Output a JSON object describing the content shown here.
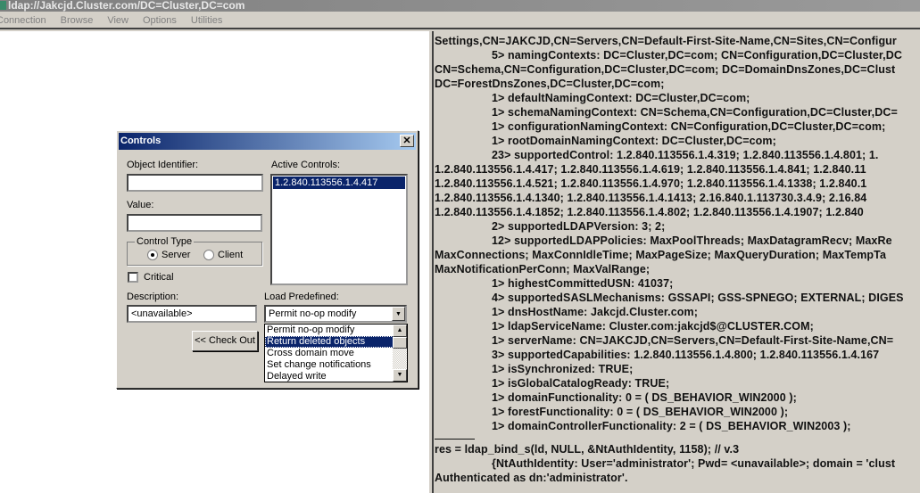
{
  "window": {
    "title": "ldap://Jakcjd.Cluster.com/DC=Cluster,DC=com"
  },
  "menu": [
    "Connection",
    "Browse",
    "View",
    "Options",
    "Utilities"
  ],
  "dialog": {
    "title": "Controls",
    "object_identifier_label": "Object Identifier:",
    "object_identifier_value": "",
    "value_label": "Value:",
    "value_value": "",
    "control_type_label": "Control Type",
    "server_label": "Server",
    "client_label": "Client",
    "selected_type": "Server",
    "critical_label": "Critical",
    "critical_checked": false,
    "description_label": "Description:",
    "description_value": "<unavailable>",
    "active_controls_label": "Active Controls:",
    "active_controls": [
      "1.2.840.113556.1.4.417"
    ],
    "load_predefined_label": "Load Predefined:",
    "load_predefined_value": "Permit no-op modify",
    "options": [
      "Permit no-op modify",
      "Return deleted objects",
      "Cross domain move",
      "Set change notifications",
      "Delayed write"
    ],
    "highlighted_option": "Return deleted objects",
    "check_out_label": "<< Check Out"
  },
  "output": {
    "lines": [
      {
        "i": false,
        "t": "Settings,CN=JAKCJD,CN=Servers,CN=Default-First-Site-Name,CN=Sites,CN=Configur"
      },
      {
        "i": true,
        "t": "5> namingContexts: DC=Cluster,DC=com; CN=Configuration,DC=Cluster,DC"
      },
      {
        "i": false,
        "t": "CN=Schema,CN=Configuration,DC=Cluster,DC=com; DC=DomainDnsZones,DC=Clust"
      },
      {
        "i": false,
        "t": "DC=ForestDnsZones,DC=Cluster,DC=com;"
      },
      {
        "i": true,
        "t": "1> defaultNamingContext: DC=Cluster,DC=com;"
      },
      {
        "i": true,
        "t": "1> schemaNamingContext: CN=Schema,CN=Configuration,DC=Cluster,DC="
      },
      {
        "i": true,
        "t": "1> configurationNamingContext: CN=Configuration,DC=Cluster,DC=com;"
      },
      {
        "i": true,
        "t": "1> rootDomainNamingContext: DC=Cluster,DC=com;"
      },
      {
        "i": true,
        "t": "23> supportedControl: 1.2.840.113556.1.4.319; 1.2.840.113556.1.4.801; 1."
      },
      {
        "i": false,
        "t": "1.2.840.113556.1.4.417; 1.2.840.113556.1.4.619; 1.2.840.113556.1.4.841; 1.2.840.11"
      },
      {
        "i": false,
        "t": "1.2.840.113556.1.4.521; 1.2.840.113556.1.4.970; 1.2.840.113556.1.4.1338; 1.2.840.1"
      },
      {
        "i": false,
        "t": "1.2.840.113556.1.4.1340; 1.2.840.113556.1.4.1413; 2.16.840.1.113730.3.4.9; 2.16.84"
      },
      {
        "i": false,
        "t": "1.2.840.113556.1.4.1852; 1.2.840.113556.1.4.802; 1.2.840.113556.1.4.1907; 1.2.840"
      },
      {
        "i": true,
        "t": "2> supportedLDAPVersion: 3; 2;"
      },
      {
        "i": true,
        "t": "12> supportedLDAPPolicies: MaxPoolThreads; MaxDatagramRecv; MaxRe"
      },
      {
        "i": false,
        "t": "MaxConnections; MaxConnIdleTime; MaxPageSize; MaxQueryDuration; MaxTempTa"
      },
      {
        "i": false,
        "t": "MaxNotificationPerConn; MaxValRange;"
      },
      {
        "i": true,
        "t": "1> highestCommittedUSN: 41037;"
      },
      {
        "i": true,
        "t": "4> supportedSASLMechanisms: GSSAPI; GSS-SPNEGO; EXTERNAL; DIGES"
      },
      {
        "i": true,
        "t": "1> dnsHostName: Jakcjd.Cluster.com;"
      },
      {
        "i": true,
        "t": "1> ldapServiceName: Cluster.com:jakcjd$@CLUSTER.COM;"
      },
      {
        "i": true,
        "t": "1> serverName: CN=JAKCJD,CN=Servers,CN=Default-First-Site-Name,CN="
      },
      {
        "i": true,
        "t": "3> supportedCapabilities: 1.2.840.113556.1.4.800; 1.2.840.113556.1.4.167"
      },
      {
        "i": true,
        "t": "1> isSynchronized: TRUE;"
      },
      {
        "i": true,
        "t": "1> isGlobalCatalogReady: TRUE;"
      },
      {
        "i": true,
        "t": "1> domainFunctionality: 0 = ( DS_BEHAVIOR_WIN2000 );"
      },
      {
        "i": true,
        "t": "1> forestFunctionality: 0 = ( DS_BEHAVIOR_WIN2000 );"
      },
      {
        "i": true,
        "t": "1> domainControllerFunctionality: 2 = ( DS_BEHAVIOR_WIN2003 );"
      }
    ],
    "after_separator": [
      {
        "i": false,
        "t": "res = ldap_bind_s(ld, NULL, &NtAuthIdentity, 1158); // v.3"
      },
      {
        "i": true,
        "t": "{NtAuthIdentity: User='administrator'; Pwd= <unavailable>; domain = 'clust"
      },
      {
        "i": false,
        "t": "Authenticated as dn:'administrator'."
      }
    ]
  }
}
